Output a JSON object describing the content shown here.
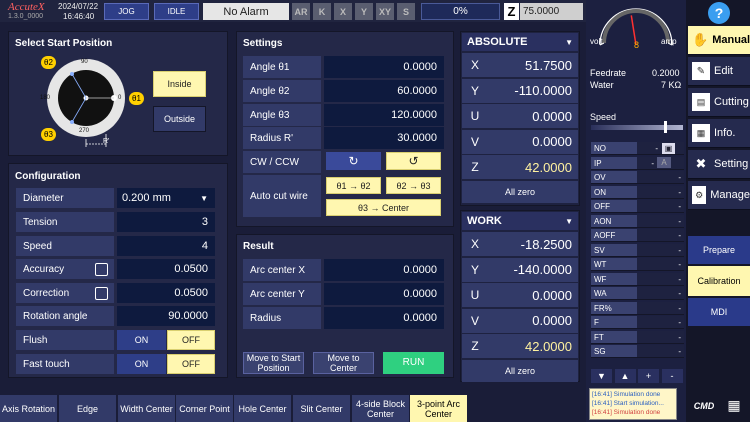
{
  "topbar": {
    "logo": "AccuteX",
    "version": "1.3.0_0000",
    "date": "2024/07/22",
    "time": "16:46:40",
    "jog": "JOG",
    "idle": "IDLE",
    "alarm": "No Alarm",
    "axes": [
      "AR",
      "K",
      "X",
      "Y",
      "XY",
      "S"
    ],
    "percent": "0%",
    "z_icon": "Z",
    "z_value": "75.0000"
  },
  "start": {
    "title": "Select Start Position",
    "theta1": "θ1",
    "theta2": "θ2",
    "theta3": "θ3",
    "deg90": "90",
    "deg180": "180",
    "deg0": "0",
    "deg270": "270",
    "rprime": "R'",
    "inside": "Inside",
    "outside": "Outside"
  },
  "config": {
    "title": "Configuration",
    "diameter_label": "Diameter",
    "diameter_value": "0.200 mm",
    "tension_label": "Tension",
    "tension_value": "3",
    "speed_label": "Speed",
    "speed_value": "4",
    "accuracy_label": "Accuracy",
    "accuracy_value": "0.0500",
    "correction_label": "Correction",
    "correction_value": "0.0500",
    "rotation_label": "Rotation angle",
    "rotation_value": "90.0000",
    "flush_label": "Flush",
    "fast_label": "Fast touch",
    "on": "ON",
    "off": "OFF"
  },
  "settings": {
    "title": "Settings",
    "a1_label": "Angle θ1",
    "a1_value": "0.0000",
    "a2_label": "Angle θ2",
    "a2_value": "60.0000",
    "a3_label": "Angle θ3",
    "a3_value": "120.0000",
    "r_label": "Radius R'",
    "r_value": "30.0000",
    "cw_label": "CW / CCW",
    "ccw_icon": "↻",
    "cw_icon": "↺",
    "auto_label": "Auto cut wire",
    "t12": "θ1 → θ2",
    "t23": "θ2 → θ3",
    "t3c": "θ3 → Center"
  },
  "result": {
    "title": "Result",
    "ax_label": "Arc center X",
    "ax_value": "0.0000",
    "ay_label": "Arc center Y",
    "ay_value": "0.0000",
    "r_label": "Radius",
    "r_value": "0.0000",
    "move_start": "Move to Start Position",
    "move_center": "Move to Center",
    "run": "RUN"
  },
  "absolute": {
    "title": "ABSOLUTE",
    "rows": [
      {
        "axis": "X",
        "value": "51.7500"
      },
      {
        "axis": "Y",
        "value": "-110.0000"
      },
      {
        "axis": "U",
        "value": "0.0000"
      },
      {
        "axis": "V",
        "value": "0.0000"
      },
      {
        "axis": "Z",
        "value": "42.0000"
      }
    ],
    "zero": "All zero"
  },
  "work": {
    "title": "WORK",
    "rows": [
      {
        "axis": "X",
        "value": "-18.2500"
      },
      {
        "axis": "Y",
        "value": "-140.0000"
      },
      {
        "axis": "U",
        "value": "0.0000"
      },
      {
        "axis": "V",
        "value": "0.0000"
      },
      {
        "axis": "Z",
        "value": "42.0000"
      }
    ],
    "zero": "All zero"
  },
  "gauge": {
    "volt": "volt",
    "value": "8",
    "amp": "amp",
    "level": 0.45
  },
  "status": {
    "feedrate_label": "Feedrate",
    "feedrate_value": "0.2000",
    "water_label": "Water",
    "water_value": "7 KΩ",
    "speed_label": "Speed",
    "speed_level": 0.8
  },
  "grid": {
    "rows": [
      {
        "k": "NO",
        "v": "-"
      },
      {
        "k": "IP",
        "v": "-"
      },
      {
        "k": "OV",
        "v": "-"
      },
      {
        "k": "ON",
        "v": "-"
      },
      {
        "k": "OFF",
        "v": "-"
      },
      {
        "k": "AON",
        "v": "-"
      },
      {
        "k": "AOFF",
        "v": "-"
      },
      {
        "k": "SV",
        "v": "-"
      },
      {
        "k": "WT",
        "v": "-"
      },
      {
        "k": "WF",
        "v": "-"
      },
      {
        "k": "WA",
        "v": "-"
      },
      {
        "k": "FR%",
        "v": "-"
      },
      {
        "k": "F",
        "v": "-"
      },
      {
        "k": "FT",
        "v": "-"
      },
      {
        "k": "SG",
        "v": "-"
      }
    ],
    "ip_mode": "A",
    "nav": [
      "▼",
      "▲",
      "+",
      "-"
    ]
  },
  "log": [
    "[16:41] Simulation done",
    "[16:41] Start simulation...",
    "[16:41] Simulation done"
  ],
  "right": {
    "help": "?",
    "manual": "Manual",
    "edit": "Edit",
    "cutting": "Cutting",
    "info": "Info.",
    "setting": "Setting",
    "manage": "Manage",
    "prepare": "Prepare",
    "calibration": "Calibration",
    "mdi": "MDI",
    "cmd": "CMD"
  },
  "tabs": [
    "Axis Rotation",
    "Edge",
    "Width Center",
    "Corner Point",
    "Hole Center",
    "Slit Center",
    "4-side Block Center",
    "3-point Arc Center"
  ]
}
